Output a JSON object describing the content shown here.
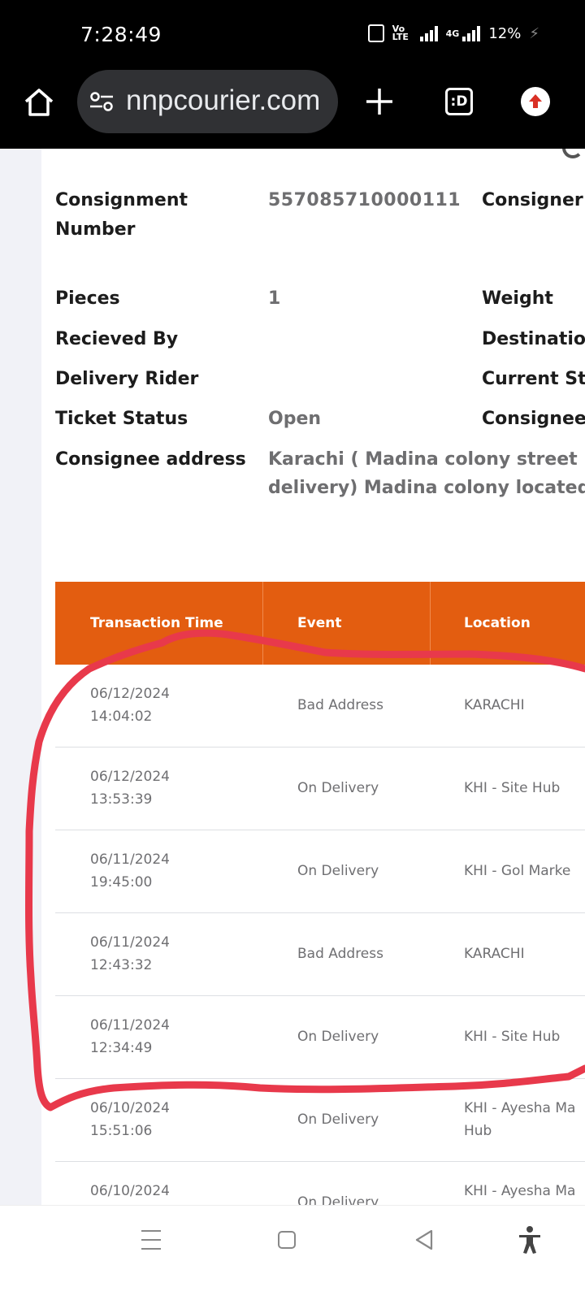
{
  "status_bar": {
    "time": "7:28:49",
    "volte": "Vo LTE",
    "network": "4G",
    "battery": "12%",
    "icons": [
      "vibrate-icon",
      "volte-icon",
      "signal-icon",
      "signal-4g-icon",
      "charging-icon"
    ]
  },
  "browser": {
    "url": "nnpcourier.com",
    "tab_indicator": ":D",
    "icons": [
      "home-icon",
      "site-settings-icon",
      "new-tab-icon",
      "tabs-icon",
      "profile-icon"
    ],
    "accent_color": "#d93025"
  },
  "details": {
    "consignment_number_label": "Consignment Number",
    "consignment_number": "557085710000111",
    "consigner_label": "Consigner",
    "pieces_label": "Pieces",
    "pieces": "1",
    "weight_label": "Weight",
    "received_by_label": "Recieved By",
    "destination_label": "Destinatio",
    "delivery_rider_label": "Delivery Rider",
    "current_status_label": "Current St",
    "ticket_status_label": "Ticket Status",
    "ticket_status": "Open",
    "consignee_label": "Consignee",
    "consignee_address_label": "Consignee address",
    "consignee_address_line1": "Karachi ( Madina colony street no",
    "consignee_address_line2": "delivery) Madina colony located ne"
  },
  "table": {
    "header_color": "#e35d10",
    "columns": [
      "Transaction Time",
      "Event",
      "Location"
    ],
    "rows": [
      {
        "date": "06/12/2024",
        "time": "14:04:02",
        "event": "Bad Address",
        "location": "KARACHI",
        "location2": ""
      },
      {
        "date": "06/12/2024",
        "time": "13:53:39",
        "event": "On Delivery",
        "location": "KHI - Site Hub",
        "location2": ""
      },
      {
        "date": "06/11/2024",
        "time": "19:45:00",
        "event": "On Delivery",
        "location": "KHI - Gol Marke",
        "location2": ""
      },
      {
        "date": "06/11/2024",
        "time": "12:43:32",
        "event": "Bad Address",
        "location": "KARACHI",
        "location2": ""
      },
      {
        "date": "06/11/2024",
        "time": "12:34:49",
        "event": "On Delivery",
        "location": "KHI - Site Hub",
        "location2": ""
      },
      {
        "date": "06/10/2024",
        "time": "15:51:06",
        "event": "On Delivery",
        "location": "KHI - Ayesha Ma",
        "location2": "Hub"
      },
      {
        "date": "06/10/2024",
        "time": "",
        "event": "On Delivery",
        "location": "KHI - Ayesha Ma",
        "location2": ""
      }
    ]
  },
  "annotation": {
    "color": "#e8394b",
    "description_icon": "red-freehand-outline"
  },
  "nav_bar": {
    "icons": [
      "recents-icon",
      "home-nav-icon",
      "back-icon",
      "accessibility-icon"
    ]
  }
}
